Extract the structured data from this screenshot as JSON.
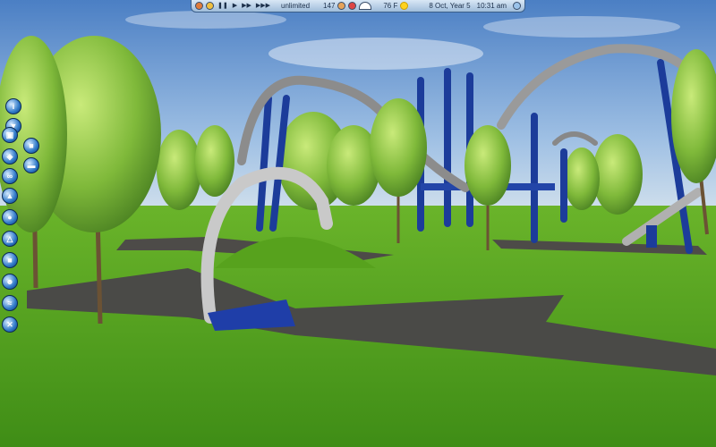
{
  "toolbar": {
    "cash": "unlimited",
    "guests": "147",
    "temperature": "76 F",
    "date": "8 Oct, Year 5",
    "time": "10:31 am"
  },
  "sidebar": {
    "items": [
      {
        "icon": "info-icon"
      },
      {
        "icon": "park-management-icon"
      },
      {
        "icon": "camera-icon"
      },
      {
        "icon": "save-icon"
      },
      {
        "icon": "rides-icon"
      },
      {
        "icon": "shops-icon"
      },
      {
        "icon": "rollercoaster-icon"
      },
      {
        "icon": "staff-icon"
      },
      {
        "icon": "scenery-icon"
      },
      {
        "icon": "terrain-icon"
      },
      {
        "icon": "paths-icon"
      },
      {
        "icon": "guests-icon"
      },
      {
        "icon": "water-icon"
      },
      {
        "icon": "delete-icon"
      }
    ]
  }
}
